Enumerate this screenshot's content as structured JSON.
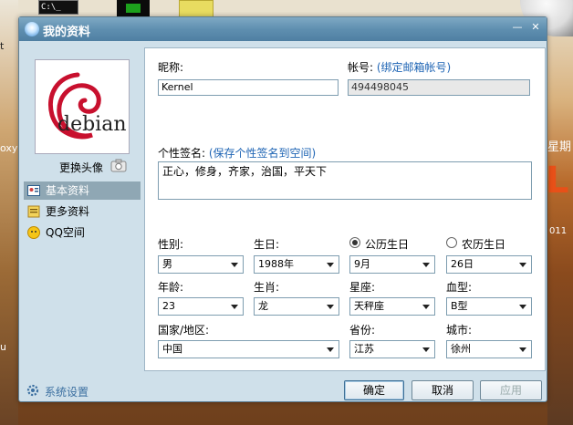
{
  "window": {
    "title": "我的资料"
  },
  "desktop": {
    "cmd_icon_text": "C:\\_",
    "left_labels": [
      "t",
      "oxy",
      "u"
    ],
    "calendar": {
      "weekday": "星期",
      "day": "L",
      "year_frag": "011"
    }
  },
  "sidebar": {
    "avatar_text": "debian",
    "change_avatar": "更换头像",
    "items": [
      {
        "label": "基本资料",
        "selected": true
      },
      {
        "label": "更多资料",
        "selected": false
      },
      {
        "label": "QQ空间",
        "selected": false
      }
    ],
    "settings": "系统设置"
  },
  "form": {
    "nickname_label": "昵称:",
    "nickname_value": "Kernel",
    "account_label": "帐号:",
    "account_link": "(绑定邮箱帐号)",
    "account_value": "494498045",
    "signature_label": "个性签名:",
    "signature_link": "(保存个性签名到空间)",
    "signature_value": "正心，修身，齐家，治国，平天下",
    "gender_label": "性别:",
    "gender_value": "男",
    "birthday_label": "生日:",
    "solar_label": "公历生日",
    "lunar_label": "农历生日",
    "birth_year": "1988年",
    "birth_month": "9月",
    "birth_day": "26日",
    "age_label": "年龄:",
    "age_value": "23",
    "zodiac_label": "生肖:",
    "zodiac_value": "龙",
    "constellation_label": "星座:",
    "constellation_value": "天秤座",
    "blood_label": "血型:",
    "blood_value": "B型",
    "country_label": "国家/地区:",
    "country_value": "中国",
    "province_label": "省份:",
    "province_value": "江苏",
    "city_label": "城市:",
    "city_value": "徐州"
  },
  "buttons": {
    "ok": "确定",
    "cancel": "取消",
    "apply": "应用"
  },
  "colors": {
    "accent": "#1e64b4",
    "titlebar": "#5f8fb0",
    "selected_nav": "#8fa7b4"
  }
}
